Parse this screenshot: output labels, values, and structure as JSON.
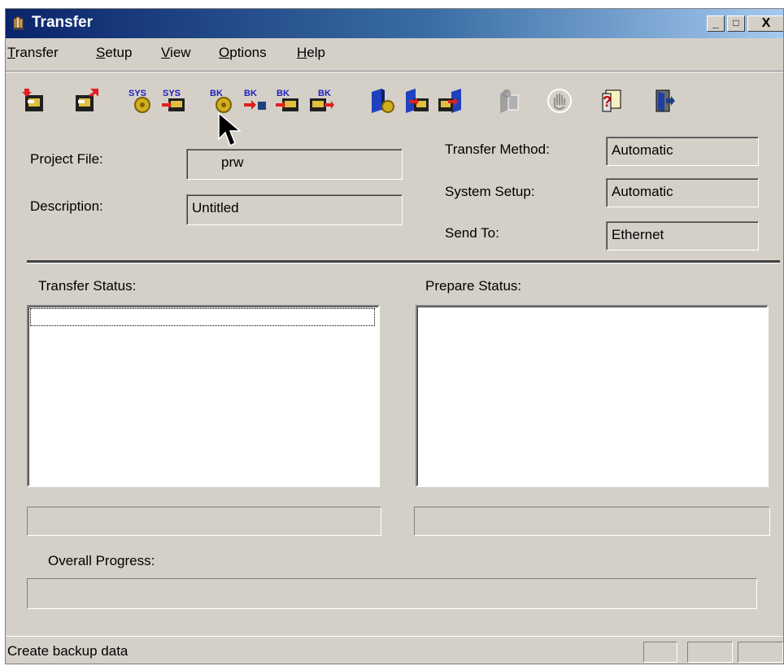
{
  "window": {
    "title": "Transfer"
  },
  "caption_buttons": {
    "minimize": "_",
    "maximize": "□",
    "close": "X"
  },
  "menu": [
    {
      "label_first": "T",
      "label_rest": "ransfer"
    },
    {
      "label_first": "S",
      "label_rest": "etup"
    },
    {
      "label_first": "V",
      "label_rest": "iew"
    },
    {
      "label_first": "O",
      "label_rest": "ptions"
    },
    {
      "label_first": "H",
      "label_rest": "elp"
    }
  ],
  "toolbar": {
    "sys_label": "SYS",
    "bk_label": "BK",
    "buttons": [
      "transfer-in-icon",
      "transfer-out-icon",
      "sys-setup-icon",
      "sys-transfer-icon",
      "bk-create-icon",
      "bk-edit-icon",
      "bk-download-icon",
      "bk-upload-icon",
      "book-setup-icon",
      "book-download-icon",
      "book-upload-icon",
      "disabled-gear-icon",
      "hand-stop-icon",
      "help-icon",
      "exit-icon"
    ]
  },
  "project": {
    "project_file_label": "Project File:",
    "project_file_value": "prw",
    "description_label": "Description:",
    "description_value": "Untitled"
  },
  "settings": {
    "transfer_method_label": "Transfer Method:",
    "transfer_method_value": "Automatic",
    "system_setup_label": "System Setup:",
    "system_setup_value": "Automatic",
    "send_to_label": "Send To:",
    "send_to_value": "Ethernet"
  },
  "status": {
    "transfer_status_label": "Transfer Status:",
    "prepare_status_label": "Prepare Status:",
    "overall_progress_label": "Overall Progress:"
  },
  "statusbar": {
    "text": "Create backup data"
  },
  "colors": {
    "titlebar_start": "#0a246a",
    "titlebar_end": "#a6caf0",
    "face": "#d4d0c8"
  }
}
